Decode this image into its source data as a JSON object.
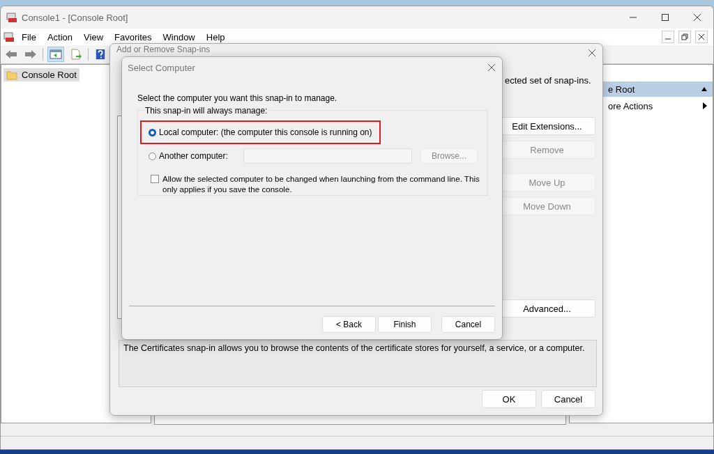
{
  "window": {
    "title": "Console1 - [Console Root]"
  },
  "menu": [
    {
      "label": "File"
    },
    {
      "label": "Action"
    },
    {
      "label": "View"
    },
    {
      "label": "Favorites"
    },
    {
      "label": "Window"
    },
    {
      "label": "Help"
    }
  ],
  "tree": [
    {
      "label": "Console Root",
      "selected": true
    }
  ],
  "actions_pane": {
    "header": "e Root",
    "items": [
      {
        "label": "ore Actions"
      }
    ]
  },
  "add_remove_dialog": {
    "title": "Add or Remove Snap-ins",
    "intro_fragment": "ected set of snap-ins.",
    "side_buttons": [
      {
        "label": "Edit Extensions...",
        "disabled": false
      },
      {
        "label": "Remove",
        "disabled": true
      },
      {
        "label": "Move Up",
        "disabled": true
      },
      {
        "label": "Move Down",
        "disabled": true
      },
      {
        "label": "Advanced...",
        "disabled": false
      }
    ],
    "description": "The Certificates snap-in allows you to browse the contents of the certificate stores for yourself, a service, or a computer.",
    "buttons": [
      {
        "label": "OK"
      },
      {
        "label": "Cancel"
      }
    ]
  },
  "select_computer_dialog": {
    "title": "Select Computer",
    "prompt": "Select the computer you want this snap-in to manage.",
    "group_label": "This snap-in will always manage:",
    "options": [
      {
        "label": "Local computer:  (the computer this console is running on)",
        "selected": true,
        "highlighted": true
      },
      {
        "label": "Another computer:",
        "selected": false,
        "highlighted": false
      }
    ],
    "computer_field": {
      "disabled": true
    },
    "browse_button": {
      "label": "Browse...",
      "disabled": true
    },
    "allow_change": {
      "label": "Allow the selected computer to be changed when launching from the command line.  This only applies if you save the console.",
      "checked": false
    },
    "buttons": [
      {
        "label": "< Back"
      },
      {
        "label": "Finish"
      },
      {
        "label": "Cancel"
      }
    ]
  }
}
